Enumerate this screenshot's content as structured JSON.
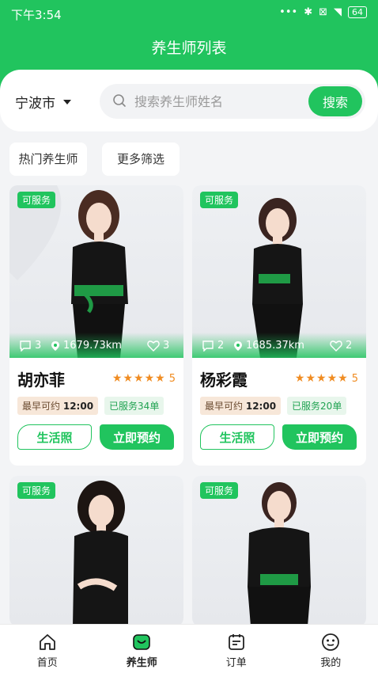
{
  "statusbar": {
    "time": "下午3:54",
    "battery": "64"
  },
  "header": {
    "title": "养生师列表"
  },
  "search": {
    "city": "宁波市",
    "placeholder": "搜索养生师姓名",
    "button": "搜索"
  },
  "filters": [
    "热门养生师",
    "更多筛选"
  ],
  "cards": [
    {
      "badge": "可服务",
      "comments": "3",
      "distance": "1679.73km",
      "likes": "3",
      "name": "胡亦菲",
      "rating": "5",
      "earliest_label": "最早可约",
      "earliest_time": "12:00",
      "served": "已服务34单",
      "btn_photos": "生活照",
      "btn_book": "立即预约"
    },
    {
      "badge": "可服务",
      "comments": "2",
      "distance": "1685.37km",
      "likes": "2",
      "name": "杨彩霞",
      "rating": "5",
      "earliest_label": "最早可约",
      "earliest_time": "12:00",
      "served": "已服务20单",
      "btn_photos": "生活照",
      "btn_book": "立即预约"
    },
    {
      "badge": "可服务"
    },
    {
      "badge": "可服务"
    }
  ],
  "tabs": [
    "首页",
    "养生师",
    "订单",
    "我的"
  ],
  "colors": {
    "brand": "#21c45e",
    "star": "#f08c22"
  }
}
